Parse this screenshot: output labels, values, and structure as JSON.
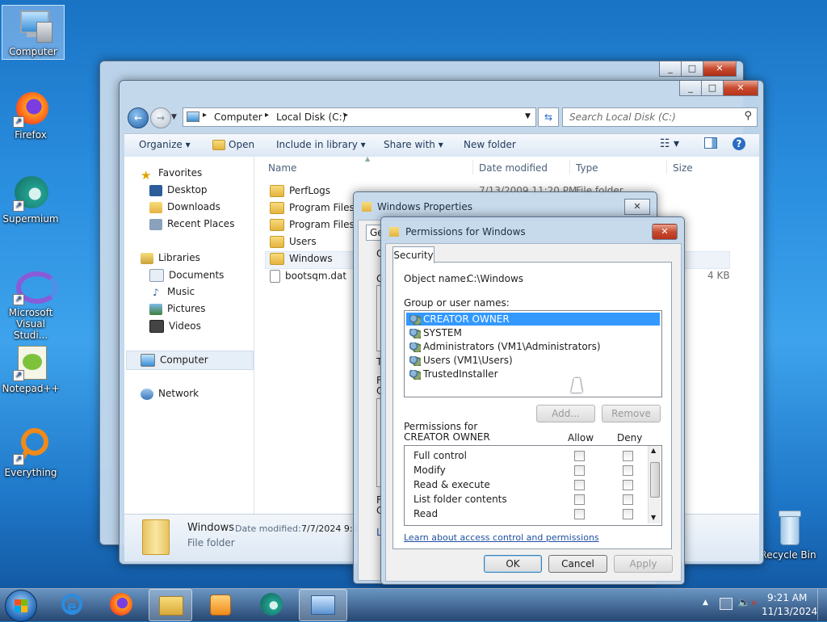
{
  "desktop": {
    "icons": [
      {
        "label": "Computer"
      },
      {
        "label": "Firefox"
      },
      {
        "label": "Supermium"
      },
      {
        "label": "Microsoft Visual Studi..."
      },
      {
        "label": "Notepad++"
      },
      {
        "label": "Everything"
      },
      {
        "label": "Recycle Bin"
      }
    ]
  },
  "explorer": {
    "path": [
      "Computer",
      "Local Disk (C:)"
    ],
    "search_placeholder": "Search Local Disk (C:)",
    "toolbar": {
      "organize": "Organize",
      "open": "Open",
      "include": "Include in library",
      "share": "Share with",
      "new_folder": "New folder"
    },
    "columns": {
      "name": "Name",
      "date": "Date modified",
      "type": "Type",
      "size": "Size"
    },
    "nav": {
      "favorites": "Favorites",
      "desktop": "Desktop",
      "downloads": "Downloads",
      "recent": "Recent Places",
      "libraries": "Libraries",
      "documents": "Documents",
      "music": "Music",
      "pictures": "Pictures",
      "videos": "Videos",
      "computer": "Computer",
      "network": "Network"
    },
    "files": [
      {
        "name": "PerfLogs",
        "date": "7/13/2009 11:20 PM",
        "type": "File folder"
      },
      {
        "name": "Program Files"
      },
      {
        "name": "Program Files (x"
      },
      {
        "name": "Users"
      },
      {
        "name": "Windows"
      },
      {
        "name": "bootsqm.dat",
        "size": "4 KB"
      }
    ],
    "details": {
      "name": "Windows",
      "date_label": "Date modified:",
      "date": "7/7/2024 9:2",
      "type": "File folder"
    }
  },
  "props": {
    "title": "Windows Properties",
    "tab_partial": "Ge",
    "letters": [
      "C",
      "G",
      "T",
      "F",
      "C",
      "F",
      "C",
      "L"
    ]
  },
  "perm": {
    "title": "Permissions for Windows",
    "tab": "Security",
    "object_label": "Object name:",
    "object_value": "C:\\Windows",
    "group_label": "Group or user names:",
    "users": [
      "CREATOR OWNER",
      "SYSTEM",
      "Administrators (VM1\\Administrators)",
      "Users (VM1\\Users)",
      "TrustedInstaller"
    ],
    "add": "Add...",
    "remove": "Remove",
    "perm_label": "Permissions for CREATOR OWNER",
    "allow": "Allow",
    "deny": "Deny",
    "perms": [
      "Full control",
      "Modify",
      "Read & execute",
      "List folder contents",
      "Read"
    ],
    "link": "Learn about access control and permissions",
    "ok": "OK",
    "cancel": "Cancel",
    "apply": "Apply"
  },
  "taskbar": {
    "time": "9:21 AM",
    "date": "11/13/2024"
  }
}
